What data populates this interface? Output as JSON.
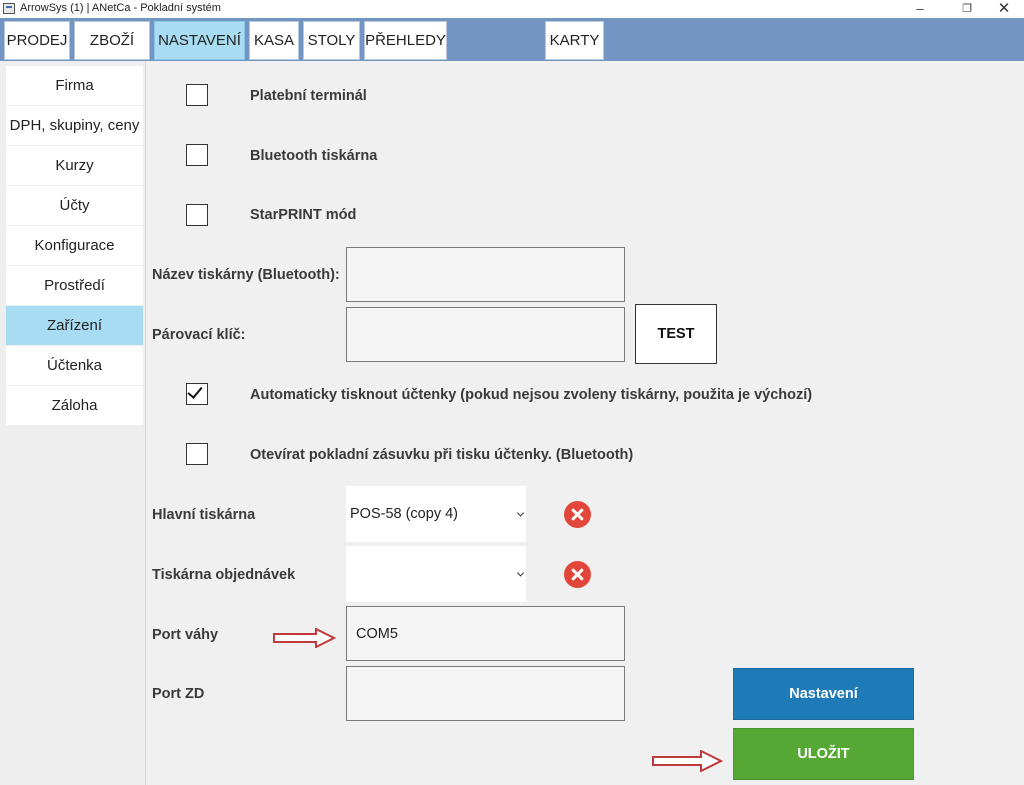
{
  "window": {
    "title": "ArrowSys (1) | ANetCa - Pokladní systém",
    "minimize_icon": "minimize-icon",
    "restore_icon": "restore-icon",
    "close_icon": "close-icon"
  },
  "topnav": {
    "tabs": [
      {
        "label": "PRODEJ"
      },
      {
        "label": "ZBOŽÍ"
      },
      {
        "label": "NASTAVENÍ",
        "active": true
      },
      {
        "label": "KASA"
      },
      {
        "label": "STOLY"
      },
      {
        "label": "PŘEHLEDY"
      },
      {
        "label": "KARTY"
      }
    ]
  },
  "sidebar": {
    "items": [
      {
        "label": "Firma"
      },
      {
        "label": "DPH, skupiny, ceny"
      },
      {
        "label": "Kurzy"
      },
      {
        "label": "Účty"
      },
      {
        "label": "Konfigurace"
      },
      {
        "label": "Prostředí"
      },
      {
        "label": "Zařízení",
        "active": true
      },
      {
        "label": "Účtenka"
      },
      {
        "label": "Záloha"
      }
    ]
  },
  "main": {
    "payment_terminal": {
      "label": "Platební terminál",
      "checked": false
    },
    "bluetooth_printer": {
      "label": "Bluetooth tiskárna",
      "checked": false
    },
    "starprint_mode": {
      "label": "StarPRINT mód",
      "checked": false
    },
    "printer_name": {
      "label": "Název tiskárny (Bluetooth):",
      "value": ""
    },
    "pairing_key": {
      "label": "Párovací klíč:",
      "value": ""
    },
    "test_button": "TEST",
    "auto_print": {
      "label": "Automaticky tisknout účtenky (pokud nejsou zvoleny tiskárny, použita je výchozí)",
      "checked": true
    },
    "open_drawer": {
      "label": "Otevírat pokladní zásuvku při tisku účtenky. (Bluetooth)",
      "checked": false
    },
    "main_printer": {
      "label": "Hlavní tiskárna",
      "value": "POS-58 (copy 4)"
    },
    "order_printer": {
      "label": "Tiskárna objednávek",
      "value": ""
    },
    "scale_port": {
      "label": "Port váhy",
      "value": "COM5"
    },
    "zd_port": {
      "label": "Port ZD",
      "value": ""
    },
    "settings_button": "Nastavení",
    "save_button": "ULOŽIT"
  },
  "colors": {
    "nav_bg": "#7295c4",
    "active_tab": "#a8dcf2",
    "settings_button": "#1f7ab8",
    "save_button": "#55a834",
    "remove_icon": "#e2463a",
    "annotation_arrow": "#c0393b"
  }
}
